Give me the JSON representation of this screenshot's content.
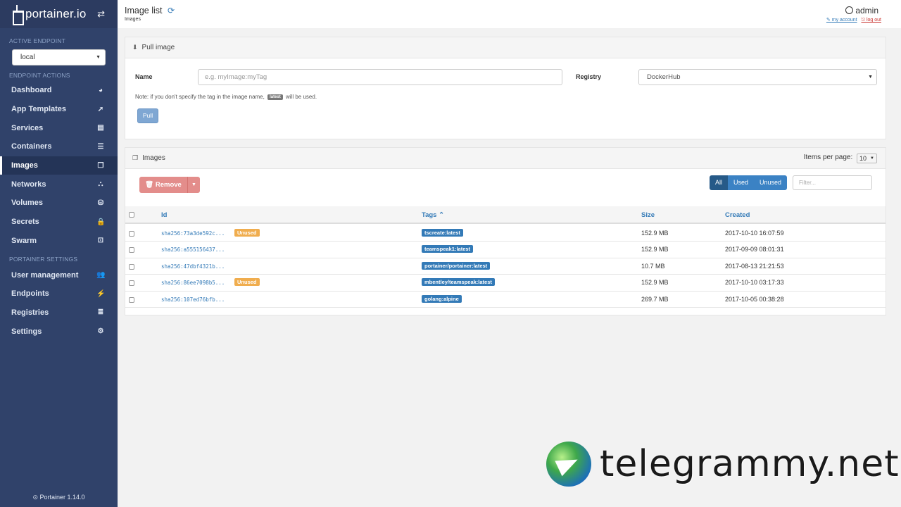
{
  "sidebar": {
    "brand": "portainer.io",
    "active_endpoint_heading": "ACTIVE ENDPOINT",
    "endpoint_value": "local",
    "endpoint_actions_heading": "ENDPOINT ACTIONS",
    "items": [
      {
        "label": "Dashboard",
        "icon": "dashboard-icon",
        "glyph": "◕"
      },
      {
        "label": "App Templates",
        "icon": "rocket-icon",
        "glyph": "➚"
      },
      {
        "label": "Services",
        "icon": "list-alt-icon",
        "glyph": "▤"
      },
      {
        "label": "Containers",
        "icon": "server-icon",
        "glyph": "☰"
      },
      {
        "label": "Images",
        "icon": "clone-icon",
        "glyph": "❐"
      },
      {
        "label": "Networks",
        "icon": "sitemap-icon",
        "glyph": "⛬"
      },
      {
        "label": "Volumes",
        "icon": "cubes-icon",
        "glyph": "⛁"
      },
      {
        "label": "Secrets",
        "icon": "user-secret-icon",
        "glyph": "🔒"
      },
      {
        "label": "Swarm",
        "icon": "object-group-icon",
        "glyph": "⊡"
      }
    ],
    "settings_heading": "PORTAINER SETTINGS",
    "settings_items": [
      {
        "label": "User management",
        "icon": "users-icon",
        "glyph": "👥"
      },
      {
        "label": "Endpoints",
        "icon": "plug-icon",
        "glyph": "⚡"
      },
      {
        "label": "Registries",
        "icon": "database-icon",
        "glyph": "≣"
      },
      {
        "label": "Settings",
        "icon": "cogs-icon",
        "glyph": "⚙"
      }
    ],
    "footer": "Portainer 1.14.0"
  },
  "header": {
    "title": "Image list",
    "breadcrumb": "Images",
    "user": "admin",
    "my_account": "my account",
    "log_out": "log out"
  },
  "pull": {
    "title": "Pull image",
    "name_label": "Name",
    "name_placeholder": "e.g. myImage:myTag",
    "registry_label": "Registry",
    "registry_value": "DockerHub",
    "note_before": "Note: if you don't specify the tag in the image name,",
    "note_code": "latest",
    "note_after": "will be used.",
    "pull_button": "Pull"
  },
  "images": {
    "title": "Images",
    "items_per_page_label": "Items per page:",
    "items_per_page_value": "10",
    "remove_button": "Remove",
    "filters": [
      "All",
      "Used",
      "Unused"
    ],
    "filter_placeholder": "Filter...",
    "columns": {
      "id": "Id",
      "tags": "Tags",
      "size": "Size",
      "created": "Created"
    },
    "unused_badge": "Unused",
    "rows": [
      {
        "id": "sha256:73a3de592c...",
        "unused": true,
        "tag": "tscreate:latest",
        "size": "152.9 MB",
        "created": "2017-10-10 16:07:59"
      },
      {
        "id": "sha256:a555156437...",
        "unused": false,
        "tag": "teamspeak1:latest",
        "size": "152.9 MB",
        "created": "2017-09-09 08:01:31"
      },
      {
        "id": "sha256:47dbf4321b...",
        "unused": false,
        "tag": "portainer/portainer:latest",
        "size": "10.7 MB",
        "created": "2017-08-13 21:21:53"
      },
      {
        "id": "sha256:86ee7098b5...",
        "unused": true,
        "tag": "mbentley/teamspeak:latest",
        "size": "152.9 MB",
        "created": "2017-10-10 03:17:33"
      },
      {
        "id": "sha256:107ed76bfb...",
        "unused": false,
        "tag": "golang:alpine",
        "size": "269.7 MB",
        "created": "2017-10-05 00:38:28"
      }
    ]
  },
  "watermark": {
    "text": "telegrammy.net"
  }
}
